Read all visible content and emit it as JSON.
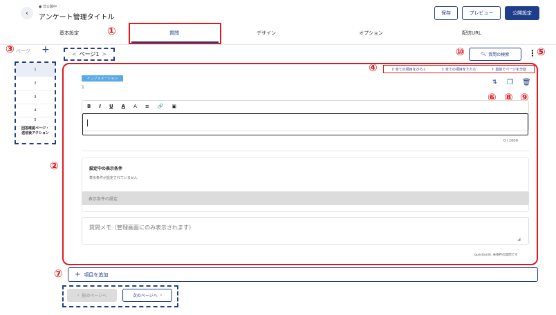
{
  "header": {
    "status": "非公開中",
    "title": "アンケート管理タイトル",
    "buttons": {
      "save": "保存",
      "preview": "プレビュー",
      "publish": "公開設定"
    }
  },
  "tabs": [
    {
      "label": "基本設定"
    },
    {
      "label": "質問"
    },
    {
      "label": "デザイン"
    },
    {
      "label": "オプション"
    },
    {
      "label": "配信URL"
    }
  ],
  "sidebar": {
    "label": "ページ",
    "add": "+",
    "items": [
      "1",
      "2",
      "3",
      "4",
      "5"
    ],
    "final_item": "回答確認ページ・\n送信後アクション"
  },
  "pagenav": {
    "label": "ページ1",
    "prev": "<",
    "next": ">"
  },
  "search_button": "質問の検索",
  "actions": {
    "expand": "全ての項目をひらく",
    "collapse": "全ての項目をたたむ",
    "split": "直前でページを分割"
  },
  "question": {
    "badge": "インフォメーション",
    "number": "1",
    "char_count": "0 / 1000",
    "condition_title": "設定中の表示条件",
    "condition_sub": "表示条件が設定されていません",
    "condition_button": "表示条件の設定",
    "memo_placeholder": "質問メモ（管理画面にのみ表示されます）",
    "question_id": "questionId: 未保存の質問です"
  },
  "toolbar": [
    "B",
    "I",
    "U",
    "A",
    "A",
    "≡",
    "🔗",
    "▣"
  ],
  "add_item": "項目を追加",
  "bottom_nav": {
    "prev": "前のページへ",
    "next": "次のページへ"
  },
  "annotations": {
    "n1": "①",
    "n2": "②",
    "n3": "③",
    "n4": "④",
    "n5": "⑤",
    "n6": "⑥",
    "n7": "⑦",
    "n8": "⑧",
    "n9": "⑨",
    "n10": "⑩"
  }
}
